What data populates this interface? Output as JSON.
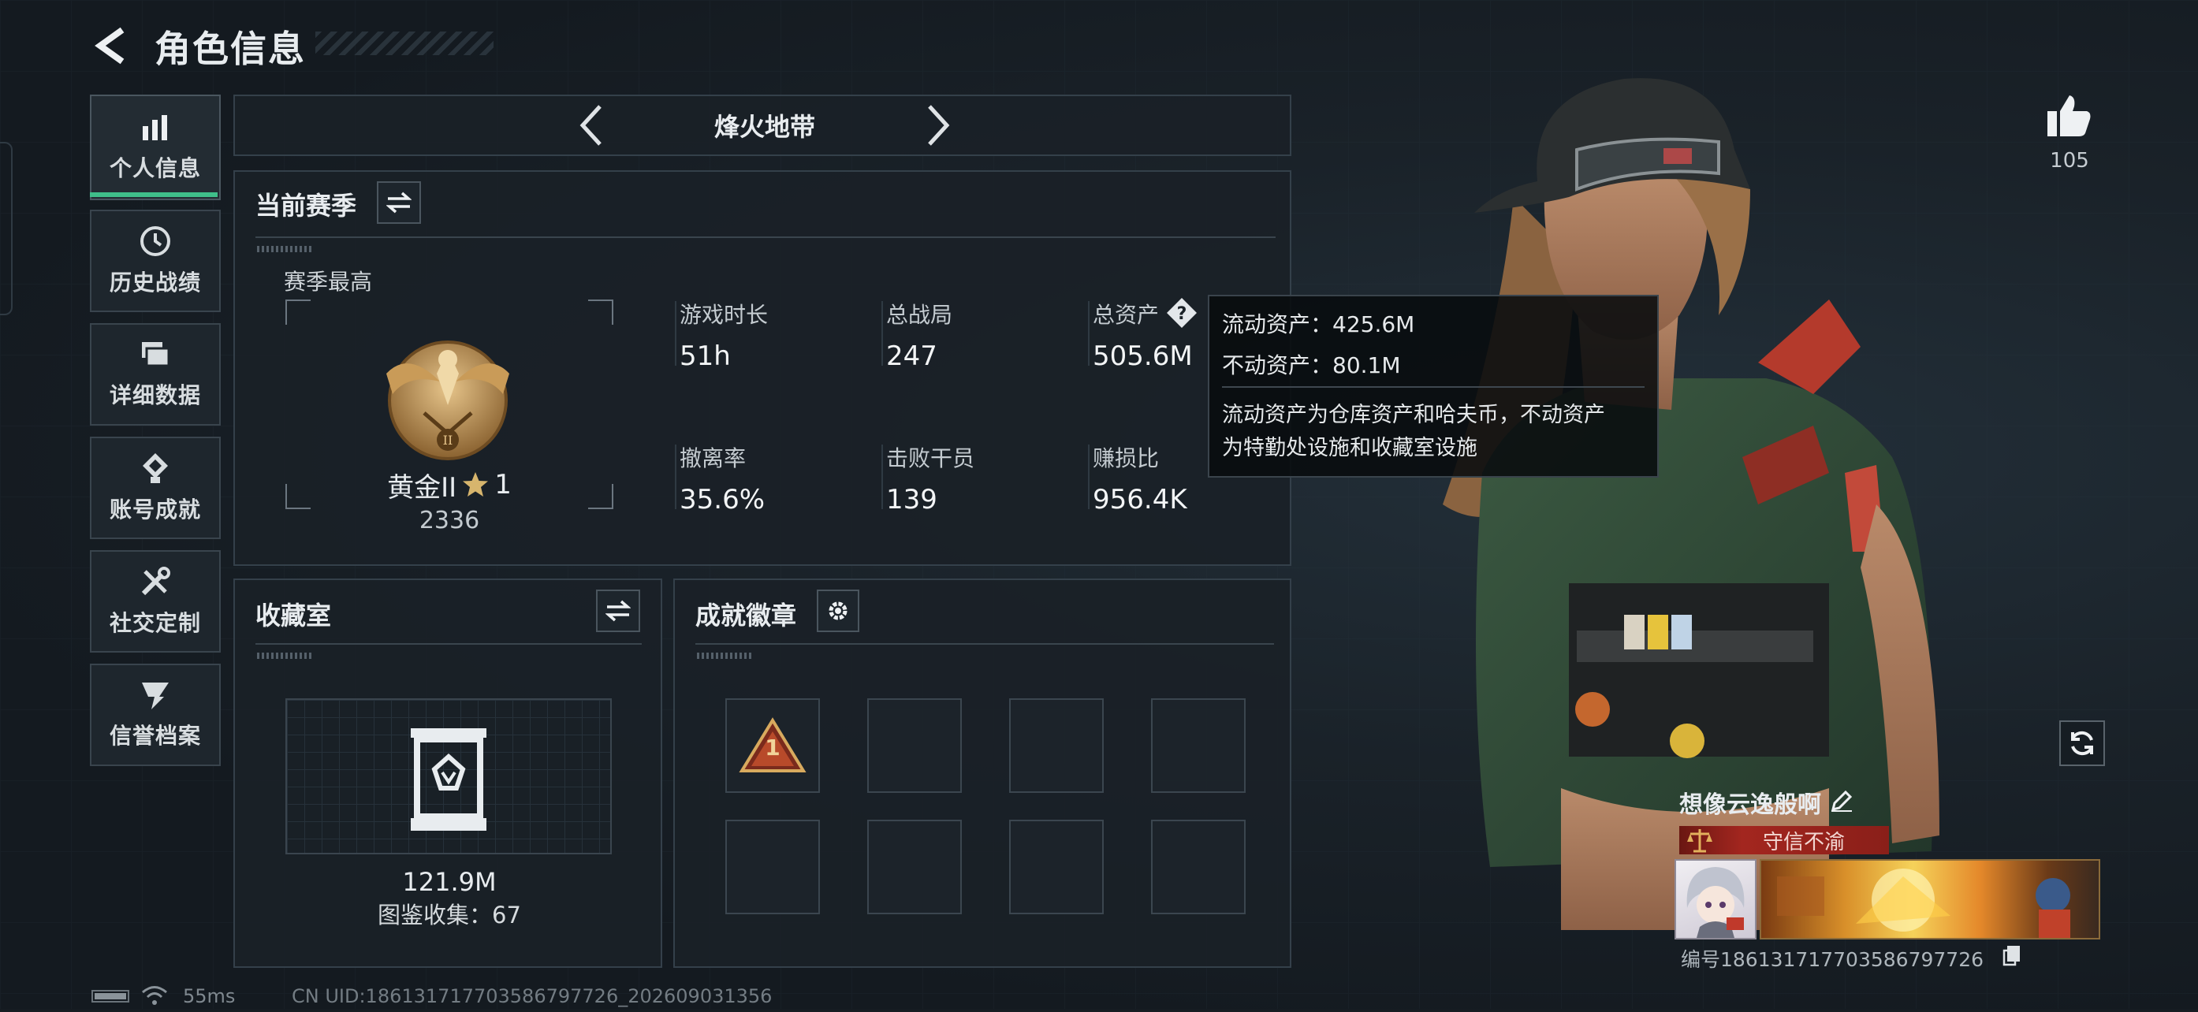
{
  "header": {
    "title": "角色信息"
  },
  "nav": {
    "items": [
      {
        "label": "个人信息",
        "icon": "bar-chart-icon",
        "active": true
      },
      {
        "label": "历史战绩",
        "icon": "clock-icon"
      },
      {
        "label": "详细数据",
        "icon": "files-icon"
      },
      {
        "label": "账号成就",
        "icon": "medal-icon"
      },
      {
        "label": "社交定制",
        "icon": "tools-icon"
      },
      {
        "label": "信誉档案",
        "icon": "reputation-icon"
      }
    ]
  },
  "mode_selector": {
    "label": "烽火地带"
  },
  "season": {
    "title": "当前赛季",
    "best_label": "赛季最高",
    "rank_name": "黄金II",
    "rank_stars": "1",
    "rank_score": "2336",
    "stats": [
      {
        "label": "游戏时长",
        "value": "51h"
      },
      {
        "label": "总战局",
        "value": "247"
      },
      {
        "label": "总资产",
        "value": "505.6M"
      },
      {
        "label": "撤离率",
        "value": "35.6%"
      },
      {
        "label": "击败干员",
        "value": "139"
      },
      {
        "label": "赚损比",
        "value": "956.4K"
      }
    ]
  },
  "tooltip": {
    "liquid": "流动资产：425.6M",
    "fixed": "不动资产：80.1M",
    "desc_line1": "流动资产为仓库资产和哈夫币，不动资产",
    "desc_line2": "为特勤处设施和收藏室设施"
  },
  "collection": {
    "title": "收藏室",
    "value": "121.9M",
    "catalog": "图鉴收集：67"
  },
  "achievements": {
    "title": "成就徽章",
    "first_badge": "1"
  },
  "likes": {
    "count": "105"
  },
  "profile": {
    "name": "想像云逸般啊",
    "reputation": "守信不渝",
    "id_line": "编号18613171770358679​7726"
  },
  "footer": {
    "ping": "55ms",
    "uid": "CN UID:1861317177035867977​26_202609031356"
  },
  "colors": {
    "accent_green": "#3fbf8a",
    "reputation_red": "#a3261f",
    "panel_border": "#34404a"
  }
}
